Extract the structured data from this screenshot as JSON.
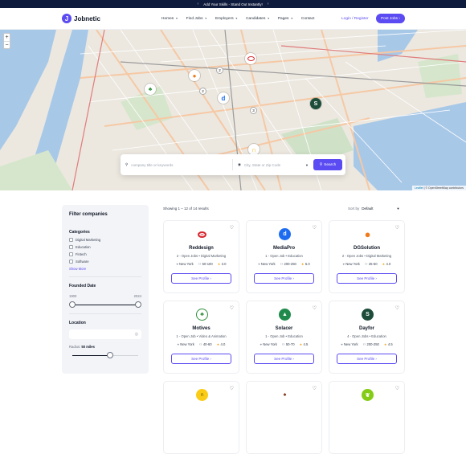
{
  "topbar": {
    "text": "Add Your Skills - Stand Out Instantly!",
    "prev_icon": "chevron-left-icon",
    "next_icon": "chevron-right-icon"
  },
  "brand": {
    "name": "Jobnetic",
    "mark": "J",
    "accent": "#5b4bf2"
  },
  "nav": {
    "items": [
      {
        "label": "Homes"
      },
      {
        "label": "Find Jobs"
      },
      {
        "label": "Employers"
      },
      {
        "label": "Candidates"
      },
      {
        "label": "Pages"
      },
      {
        "label": "Contact"
      }
    ],
    "login": "Login / Register",
    "post_job": "Post Jobs"
  },
  "map": {
    "zoom_in": "+",
    "zoom_out": "−",
    "attribution_leaflet": "Leaflet",
    "attribution_rest": " | © OpenStreetMap contributors",
    "clusters": [
      "2",
      "2",
      "3"
    ]
  },
  "search": {
    "keyword_placeholder": "company title or keywords",
    "location_placeholder": "City, State or Zip Code",
    "button": "Search"
  },
  "filter": {
    "title": "Filter companies",
    "categories_title": "Categories",
    "categories": [
      "Digital Marketing",
      "Education",
      "Fintech",
      "Software"
    ],
    "show_more": "Show More",
    "founded_title": "Founded Date",
    "founded_min": "1900",
    "founded_max": "2024",
    "location_title": "Location",
    "radius_label": "Radius:",
    "radius_value": "50 miles"
  },
  "results": {
    "showing": "Showing 1 – 12 of 14 results",
    "sort_label": "Sort by",
    "sort_value": "Default"
  },
  "companies": [
    {
      "name": "Reddesign",
      "jobs": "2 - Open Jobs",
      "sector": "Digital Marketing",
      "city": "New York",
      "size": "50-100",
      "rating": "3.0",
      "logo_color": "#d6262d",
      "logo_icon": "oval-logo-icon",
      "button": "See Profile"
    },
    {
      "name": "MediaPro",
      "jobs": "1 - Open Job",
      "sector": "Education",
      "city": "New York",
      "size": "200-250",
      "rating": "5.0",
      "logo_color": "#1d6cf0",
      "logo_icon": "d-logo-icon",
      "button": "See Profile"
    },
    {
      "name": "DGSolution",
      "jobs": "2 - Open Jobs",
      "sector": "Digital Marketing",
      "city": "New York",
      "size": "25-50",
      "rating": "4.0",
      "logo_color": "#f07b1d",
      "logo_icon": "orange-logo-icon",
      "button": "See Profile"
    },
    {
      "name": "Motives",
      "jobs": "1 - Open Job",
      "sector": "Video & Animation",
      "city": "New York",
      "size": "40-60",
      "rating": "4.0",
      "logo_color": "#2f8f3a",
      "logo_icon": "tree-logo-icon",
      "button": "See Profile"
    },
    {
      "name": "Solacer",
      "jobs": "1 - Open Job",
      "sector": "Education",
      "city": "New York",
      "size": "50-70",
      "rating": "4.5",
      "logo_color": "#1f8a4c",
      "logo_icon": "pine-logo-icon",
      "button": "See Profile"
    },
    {
      "name": "Dayfor",
      "jobs": "4 - Open Jobs",
      "sector": "Education",
      "city": "New York",
      "size": "200-250",
      "rating": "4.5",
      "logo_color": "#1d4d3a",
      "logo_icon": "s-logo-icon",
      "button": "See Profile"
    }
  ],
  "bottom_row_logos": [
    "headset-logo-icon",
    "mask-logo-icon",
    "leaf-logo-icon"
  ]
}
